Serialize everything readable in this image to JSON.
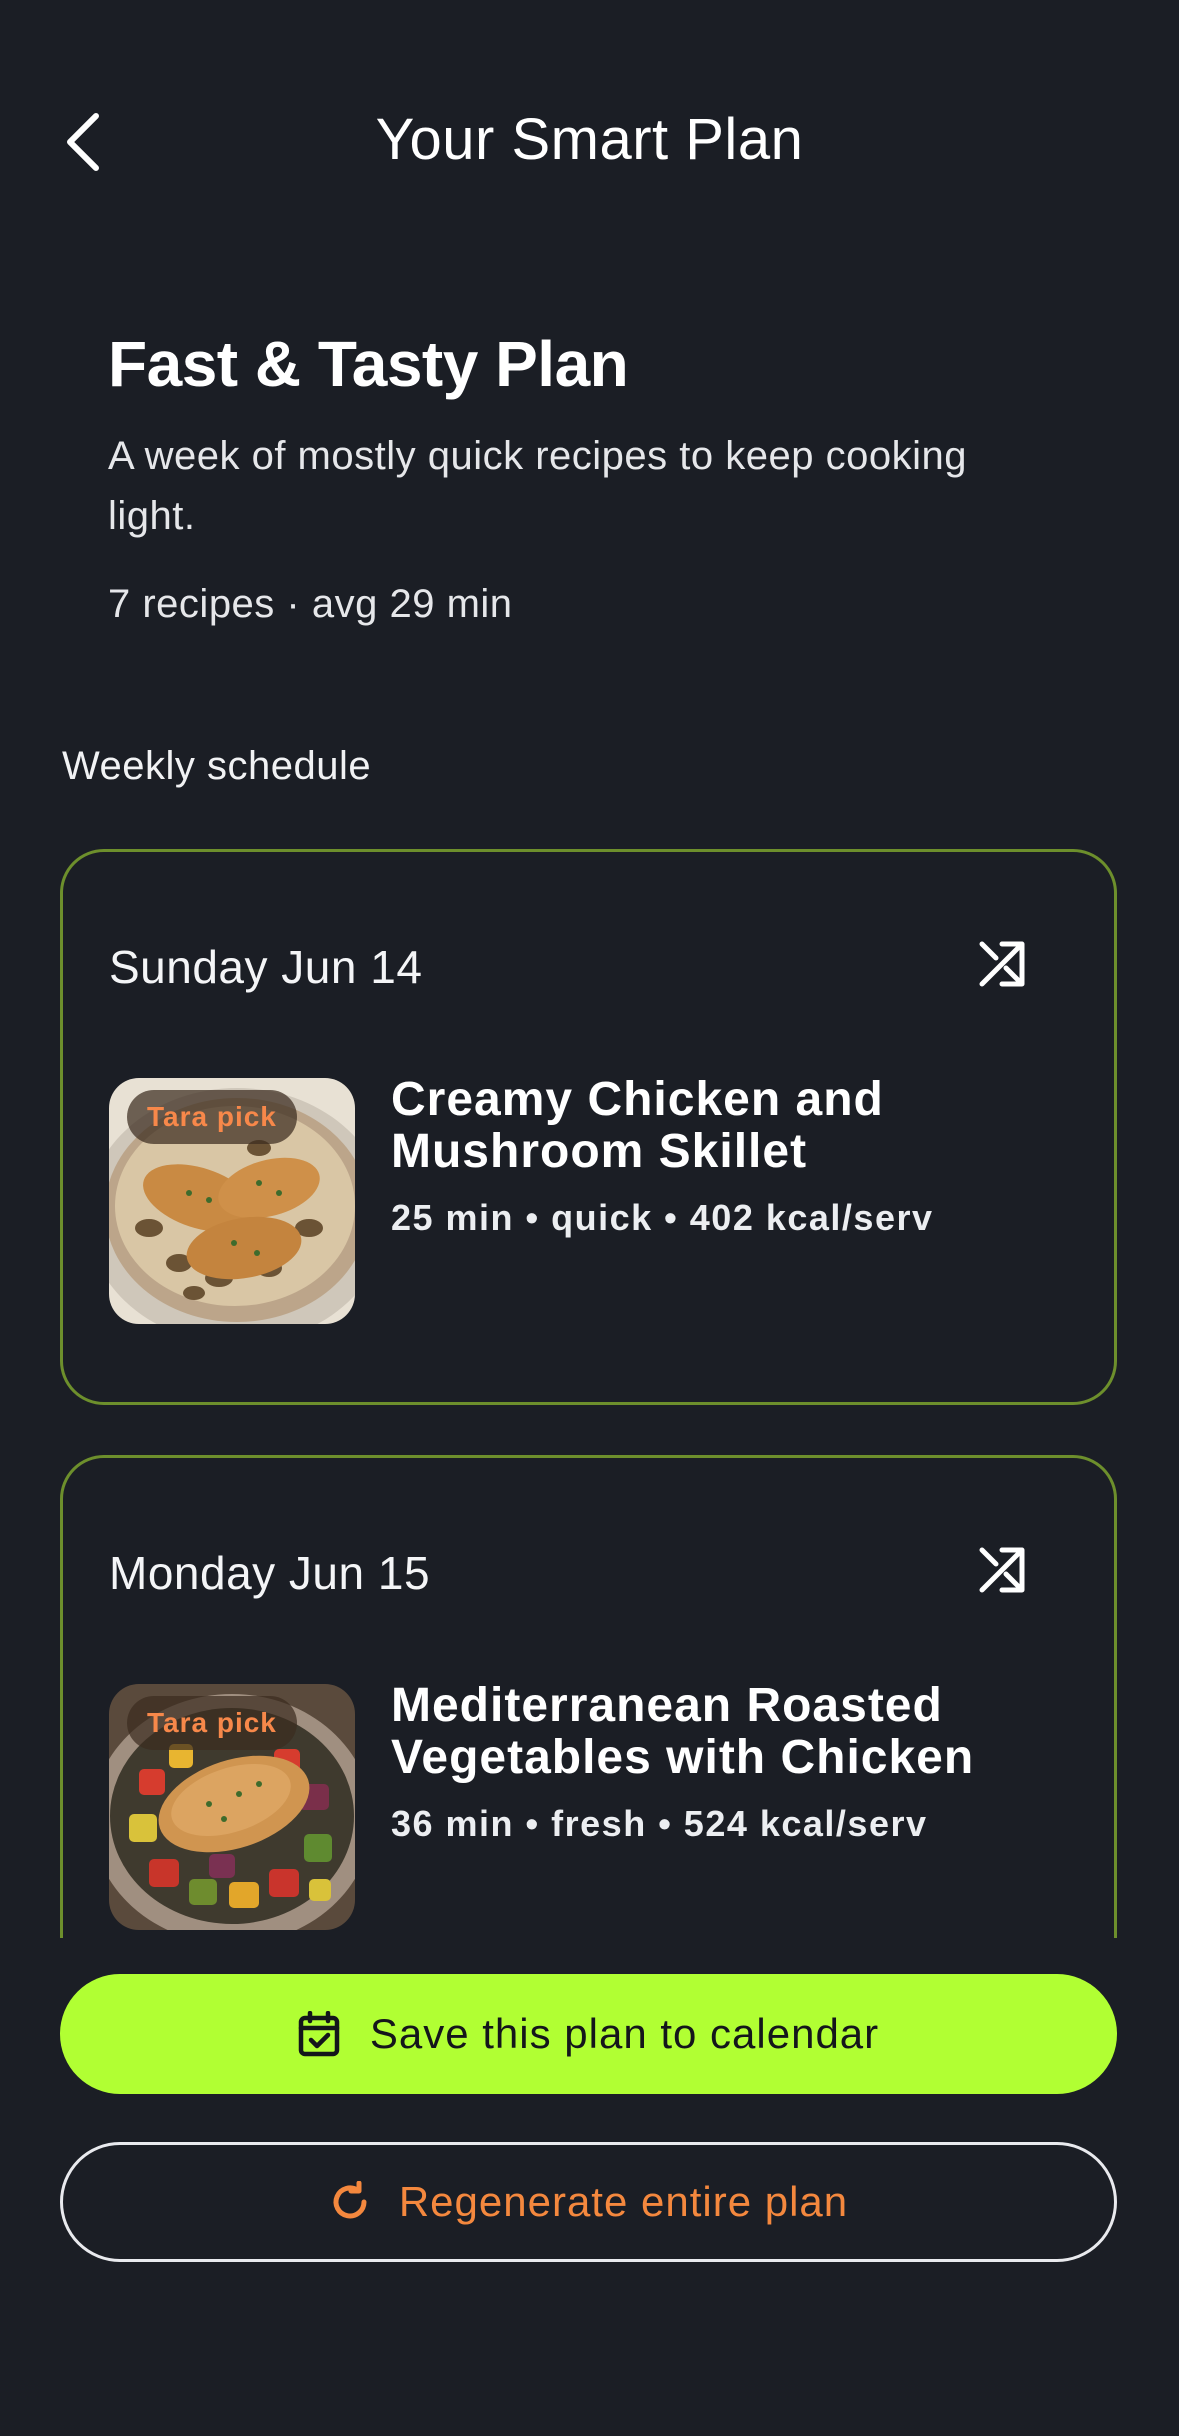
{
  "header": {
    "title": "Your Smart Plan",
    "back_icon": "chevron-left-icon"
  },
  "plan": {
    "name": "Fast & Tasty Plan",
    "description": "A week of mostly quick recipes to keep cooking light.",
    "meta": "7 recipes · avg 29 min"
  },
  "schedule": {
    "label": "Weekly schedule",
    "days": [
      {
        "date": "Sunday Jun 14",
        "badge": "Tara pick",
        "recipe_title": "Creamy Chicken and Mushroom Skillet",
        "recipe_meta": "25 min • quick • 402 kcal/serv"
      },
      {
        "date": "Monday Jun 15",
        "badge": "Tara pick",
        "recipe_title": "Mediterranean Roasted Vegetables with Chicken",
        "recipe_meta": "36 min • fresh • 524 kcal/serv"
      }
    ]
  },
  "actions": {
    "save_label": "Save this plan to calendar",
    "regenerate_label": "Regenerate entire plan"
  },
  "colors": {
    "background": "#1b1e25",
    "card_border": "#6d8f2c",
    "primary_button": "#b1ff33",
    "accent_orange": "#f4883e"
  }
}
